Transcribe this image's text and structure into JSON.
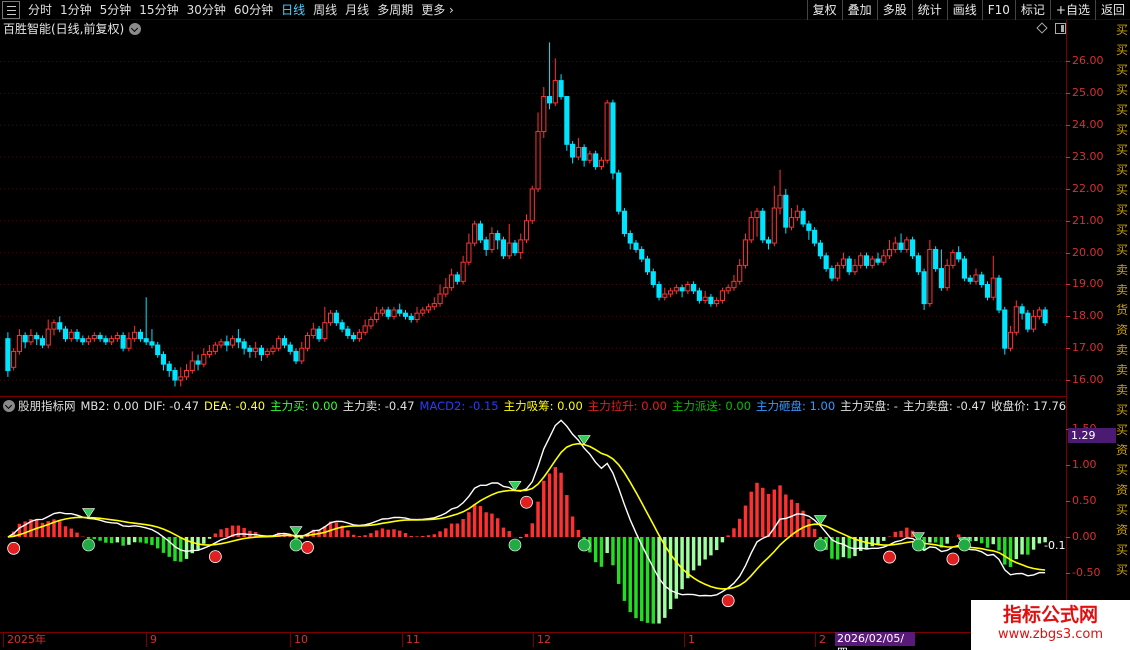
{
  "toolbar": {
    "period_tabs": [
      "分时",
      "1分钟",
      "5分钟",
      "15分钟",
      "30分钟",
      "60分钟",
      "日线",
      "周线",
      "月线",
      "多周期",
      "更多"
    ],
    "active_tab": "日线",
    "more_label": "更多",
    "right_tools": [
      "复权",
      "叠加",
      "多股",
      "统计",
      "画线",
      "F10",
      "标记",
      "+自选",
      "返回"
    ]
  },
  "main_chart": {
    "title": "百胜智能(日线,前复权)",
    "price_ticks": [
      "26.00",
      "25.00",
      "24.00",
      "23.00",
      "22.00",
      "21.00",
      "20.00",
      "19.00",
      "18.00",
      "17.00",
      "16.00"
    ],
    "colors": {
      "up": "#ff3333",
      "down": "#00e5ff",
      "grid": "#6a0000"
    }
  },
  "indicator": {
    "name": "股朋指标网",
    "items": [
      {
        "text": "MB2: 0.00",
        "color": "#e0e0e0"
      },
      {
        "text": "DIF: -0.47",
        "color": "#e0e0e0"
      },
      {
        "text": "DEA: -0.40",
        "color": "#ffff33"
      },
      {
        "text": "主力买: 0.00",
        "color": "#33ff33"
      },
      {
        "text": "主力卖: -0.47",
        "color": "#e0e0e0"
      },
      {
        "text": "MACD2: -0.15",
        "color": "#2a3cff"
      },
      {
        "text": "主力吸筹: 0.00",
        "color": "#ffff00"
      },
      {
        "text": "主力拉升: 0.00",
        "color": "#e02020"
      },
      {
        "text": "主力派送: 0.00",
        "color": "#00c000"
      },
      {
        "text": "主力砸盘: 1.00",
        "color": "#3399ff"
      },
      {
        "text": "主力买盘: -",
        "color": "#e0e0e0"
      },
      {
        "text": "主力卖盘: -0.47",
        "color": "#e0e0e0"
      },
      {
        "text": "收盘价: 17.76",
        "color": "#e0e0e0"
      }
    ],
    "axis_ticks": [
      "1.50",
      "1.00",
      "0.50",
      "0.00",
      "-0.50"
    ],
    "current_value": "1.29",
    "right_value": "-0.1",
    "marker_buy": "买",
    "marker_sell": "卖",
    "marker_empty": "空"
  },
  "date_axis": {
    "labels": [
      "2025年",
      "9",
      "10",
      "11",
      "12",
      "1",
      "2"
    ],
    "highlighted_date": "2026/02/05/四"
  },
  "right_strip_text": "买买买买买买买买买买买买卖卖货资卖卖卖买买资买资买资买买",
  "watermark": {
    "title": "指标公式网",
    "url": "www.zbgs3.com"
  },
  "chart_data": {
    "type": "candlestick",
    "title": "百胜智能(日线,前复权)",
    "ylim": [
      15.5,
      26.8
    ],
    "x_labels": [
      "2025年",
      "9",
      "10",
      "11",
      "12",
      "1",
      "2"
    ],
    "candles": [
      [
        17.3,
        16.3,
        17.5,
        16.1
      ],
      [
        16.4,
        16.9,
        17.0,
        16.3
      ],
      [
        16.9,
        17.4,
        17.6,
        16.8
      ],
      [
        17.4,
        17.2,
        17.5,
        17.0
      ],
      [
        17.2,
        17.4,
        17.6,
        17.1
      ],
      [
        17.4,
        17.3,
        17.5,
        17.1
      ],
      [
        17.3,
        17.1,
        17.4,
        17.0
      ],
      [
        17.1,
        17.6,
        17.9,
        17.0
      ],
      [
        17.6,
        17.8,
        17.9,
        17.4
      ],
      [
        17.8,
        17.6,
        18.0,
        17.5
      ],
      [
        17.6,
        17.3,
        17.7,
        17.2
      ],
      [
        17.3,
        17.5,
        17.6,
        17.2
      ],
      [
        17.5,
        17.3,
        17.6,
        17.2
      ],
      [
        17.3,
        17.2,
        17.4,
        17.1
      ],
      [
        17.2,
        17.3,
        17.4,
        17.1
      ],
      [
        17.3,
        17.4,
        17.5,
        17.2
      ],
      [
        17.4,
        17.3,
        17.5,
        17.2
      ],
      [
        17.3,
        17.2,
        17.4,
        17.1
      ],
      [
        17.2,
        17.3,
        17.4,
        17.1
      ],
      [
        17.3,
        17.4,
        17.5,
        17.2
      ],
      [
        17.4,
        17.0,
        17.5,
        16.9
      ],
      [
        17.0,
        17.3,
        17.5,
        16.9
      ],
      [
        17.3,
        17.5,
        17.7,
        17.2
      ],
      [
        17.5,
        17.3,
        17.6,
        17.2
      ],
      [
        17.3,
        17.2,
        18.6,
        17.1
      ],
      [
        17.2,
        17.1,
        17.6,
        17.0
      ],
      [
        17.1,
        16.8,
        17.2,
        16.7
      ],
      [
        16.8,
        16.5,
        16.9,
        16.3
      ],
      [
        16.5,
        16.3,
        16.6,
        16.1
      ],
      [
        16.3,
        16.0,
        16.4,
        15.8
      ],
      [
        16.0,
        16.1,
        16.4,
        15.8
      ],
      [
        16.1,
        16.3,
        16.5,
        16.0
      ],
      [
        16.3,
        16.6,
        16.9,
        16.2
      ],
      [
        16.6,
        16.5,
        16.8,
        16.3
      ],
      [
        16.5,
        16.8,
        17.0,
        16.4
      ],
      [
        16.8,
        16.9,
        17.1,
        16.7
      ],
      [
        16.9,
        17.1,
        17.2,
        16.8
      ],
      [
        17.1,
        17.2,
        17.3,
        17.0
      ],
      [
        17.2,
        17.1,
        17.4,
        16.9
      ],
      [
        17.1,
        17.3,
        17.4,
        17.0
      ],
      [
        17.3,
        17.2,
        17.6,
        17.0
      ],
      [
        17.2,
        17.0,
        17.3,
        16.8
      ],
      [
        17.0,
        16.9,
        17.1,
        16.7
      ],
      [
        16.9,
        17.0,
        17.2,
        16.7
      ],
      [
        17.0,
        16.8,
        17.1,
        16.6
      ],
      [
        16.8,
        16.9,
        17.0,
        16.7
      ],
      [
        16.9,
        17.0,
        17.1,
        16.8
      ],
      [
        17.0,
        17.3,
        17.4,
        16.9
      ],
      [
        17.3,
        17.1,
        17.4,
        17.0
      ],
      [
        17.1,
        16.9,
        17.2,
        16.8
      ],
      [
        16.9,
        16.6,
        17.0,
        16.5
      ],
      [
        16.6,
        17.0,
        17.2,
        16.5
      ],
      [
        17.0,
        17.4,
        17.5,
        16.9
      ],
      [
        17.4,
        17.6,
        17.8,
        17.3
      ],
      [
        17.6,
        17.3,
        17.7,
        17.2
      ],
      [
        17.3,
        17.8,
        18.3,
        17.2
      ],
      [
        17.8,
        18.1,
        18.2,
        17.7
      ],
      [
        18.1,
        17.8,
        18.2,
        17.7
      ],
      [
        17.8,
        17.6,
        17.9,
        17.5
      ],
      [
        17.6,
        17.4,
        17.7,
        17.3
      ],
      [
        17.4,
        17.3,
        17.5,
        17.2
      ],
      [
        17.3,
        17.5,
        17.6,
        17.2
      ],
      [
        17.5,
        17.7,
        17.9,
        17.4
      ],
      [
        17.7,
        17.9,
        18.0,
        17.6
      ],
      [
        17.9,
        18.1,
        18.3,
        17.8
      ],
      [
        18.1,
        18.2,
        18.3,
        18.0
      ],
      [
        18.2,
        18.0,
        18.3,
        17.9
      ],
      [
        18.0,
        18.2,
        18.3,
        17.9
      ],
      [
        18.2,
        18.1,
        18.4,
        18.0
      ],
      [
        18.1,
        18.0,
        18.2,
        17.9
      ],
      [
        18.0,
        17.9,
        18.1,
        17.8
      ],
      [
        17.9,
        18.1,
        18.3,
        17.8
      ],
      [
        18.1,
        18.2,
        18.3,
        18.0
      ],
      [
        18.2,
        18.3,
        18.4,
        18.1
      ],
      [
        18.3,
        18.4,
        18.6,
        18.2
      ],
      [
        18.4,
        18.7,
        19.0,
        18.3
      ],
      [
        18.7,
        18.9,
        19.2,
        18.6
      ],
      [
        18.9,
        19.3,
        19.5,
        18.8
      ],
      [
        19.3,
        19.1,
        19.4,
        19.0
      ],
      [
        19.1,
        19.7,
        19.9,
        19.0
      ],
      [
        19.7,
        20.3,
        20.6,
        19.6
      ],
      [
        20.3,
        20.9,
        21.0,
        20.2
      ],
      [
        20.9,
        20.4,
        21.0,
        20.3
      ],
      [
        20.4,
        20.1,
        20.5,
        19.9
      ],
      [
        20.1,
        20.6,
        20.8,
        20.0
      ],
      [
        20.6,
        20.4,
        20.7,
        20.1
      ],
      [
        20.4,
        19.9,
        20.5,
        19.8
      ],
      [
        19.9,
        20.3,
        20.9,
        19.8
      ],
      [
        20.3,
        20.0,
        20.4,
        19.9
      ],
      [
        20.0,
        20.4,
        20.6,
        19.8
      ],
      [
        20.4,
        21.0,
        21.2,
        20.3
      ],
      [
        21.0,
        22.0,
        22.1,
        20.9
      ],
      [
        22.0,
        23.8,
        24.4,
        21.9
      ],
      [
        23.8,
        24.9,
        25.2,
        23.6
      ],
      [
        24.9,
        24.7,
        26.6,
        24.5
      ],
      [
        24.7,
        25.4,
        26.1,
        24.6
      ],
      [
        25.4,
        24.9,
        25.6,
        24.8
      ],
      [
        24.9,
        23.4,
        24.9,
        23.2
      ],
      [
        23.4,
        23.0,
        23.5,
        22.8
      ],
      [
        23.0,
        23.3,
        23.6,
        22.9
      ],
      [
        23.3,
        22.9,
        23.4,
        22.7
      ],
      [
        22.9,
        23.1,
        23.2,
        22.8
      ],
      [
        23.1,
        22.7,
        23.2,
        22.6
      ],
      [
        22.7,
        22.9,
        23.0,
        22.6
      ],
      [
        22.9,
        24.7,
        24.8,
        22.8
      ],
      [
        24.7,
        22.5,
        24.8,
        22.3
      ],
      [
        22.5,
        21.3,
        22.6,
        21.2
      ],
      [
        21.3,
        20.6,
        21.4,
        20.5
      ],
      [
        20.6,
        20.3,
        20.7,
        20.1
      ],
      [
        20.3,
        20.1,
        20.4,
        20.0
      ],
      [
        20.1,
        19.8,
        20.2,
        19.7
      ],
      [
        19.8,
        19.4,
        19.9,
        19.3
      ],
      [
        19.4,
        19.0,
        19.5,
        18.9
      ],
      [
        19.0,
        18.6,
        19.1,
        18.5
      ],
      [
        18.6,
        18.7,
        18.9,
        18.5
      ],
      [
        18.7,
        18.8,
        18.9,
        18.6
      ],
      [
        18.8,
        18.9,
        19.0,
        18.7
      ],
      [
        18.9,
        18.8,
        19.0,
        18.6
      ],
      [
        18.8,
        19.0,
        19.1,
        18.7
      ],
      [
        19.0,
        18.8,
        19.1,
        18.7
      ],
      [
        18.8,
        18.5,
        18.9,
        18.4
      ],
      [
        18.5,
        18.6,
        18.8,
        18.4
      ],
      [
        18.6,
        18.4,
        18.7,
        18.3
      ],
      [
        18.4,
        18.5,
        18.6,
        18.3
      ],
      [
        18.5,
        18.8,
        18.9,
        18.4
      ],
      [
        18.8,
        18.9,
        19.0,
        18.7
      ],
      [
        18.9,
        19.1,
        19.3,
        18.8
      ],
      [
        19.1,
        19.6,
        19.8,
        19.0
      ],
      [
        19.6,
        20.4,
        20.6,
        19.5
      ],
      [
        20.4,
        21.1,
        21.3,
        20.3
      ],
      [
        21.1,
        21.3,
        21.4,
        20.5
      ],
      [
        21.3,
        20.4,
        21.4,
        20.3
      ],
      [
        20.4,
        20.3,
        20.5,
        20.1
      ],
      [
        20.3,
        21.4,
        22.1,
        20.2
      ],
      [
        21.4,
        21.8,
        22.6,
        21.2
      ],
      [
        21.8,
        20.8,
        22.0,
        20.6
      ],
      [
        20.8,
        21.1,
        21.4,
        20.7
      ],
      [
        21.1,
        21.3,
        21.5,
        21.0
      ],
      [
        21.3,
        20.9,
        21.4,
        20.8
      ],
      [
        20.9,
        20.7,
        21.0,
        20.4
      ],
      [
        20.7,
        20.3,
        20.8,
        20.2
      ],
      [
        20.3,
        19.9,
        20.4,
        19.8
      ],
      [
        19.9,
        19.5,
        20.0,
        19.4
      ],
      [
        19.5,
        19.2,
        19.6,
        19.1
      ],
      [
        19.2,
        19.6,
        19.7,
        19.1
      ],
      [
        19.6,
        19.8,
        20.0,
        19.5
      ],
      [
        19.8,
        19.4,
        19.9,
        19.3
      ],
      [
        19.4,
        19.6,
        19.8,
        19.3
      ],
      [
        19.6,
        19.9,
        20.0,
        19.5
      ],
      [
        19.9,
        19.6,
        20.0,
        19.5
      ],
      [
        19.6,
        19.8,
        19.9,
        19.5
      ],
      [
        19.8,
        19.7,
        20.0,
        19.6
      ],
      [
        19.7,
        19.9,
        20.1,
        19.6
      ],
      [
        19.9,
        20.1,
        20.4,
        19.8
      ],
      [
        20.1,
        20.3,
        20.5,
        20.0
      ],
      [
        20.3,
        20.1,
        20.6,
        20.0
      ],
      [
        20.1,
        20.4,
        20.5,
        20.0
      ],
      [
        20.4,
        19.9,
        20.5,
        19.8
      ],
      [
        19.9,
        19.4,
        20.0,
        19.3
      ],
      [
        19.4,
        18.4,
        19.5,
        18.2
      ],
      [
        18.4,
        20.1,
        20.4,
        18.3
      ],
      [
        20.1,
        19.5,
        20.2,
        19.4
      ],
      [
        19.5,
        18.9,
        20.1,
        18.8
      ],
      [
        18.9,
        19.6,
        19.8,
        18.8
      ],
      [
        19.6,
        20.0,
        20.1,
        19.5
      ],
      [
        20.0,
        19.8,
        20.2,
        19.7
      ],
      [
        19.8,
        19.2,
        19.9,
        19.1
      ],
      [
        19.2,
        19.1,
        19.3,
        19.0
      ],
      [
        19.1,
        19.3,
        19.5,
        19.0
      ],
      [
        19.3,
        19.0,
        19.4,
        18.9
      ],
      [
        19.0,
        18.6,
        19.1,
        18.5
      ],
      [
        18.6,
        19.2,
        19.9,
        18.5
      ],
      [
        19.2,
        18.2,
        19.3,
        18.1
      ],
      [
        18.2,
        17.0,
        18.3,
        16.8
      ],
      [
        17.0,
        17.5,
        17.7,
        16.9
      ],
      [
        17.5,
        18.3,
        18.5,
        17.4
      ],
      [
        18.3,
        18.1,
        18.4,
        17.9
      ],
      [
        18.1,
        17.6,
        18.2,
        17.5
      ],
      [
        17.6,
        18.0,
        18.2,
        17.5
      ],
      [
        18.0,
        18.2,
        18.3,
        17.9
      ],
      [
        18.2,
        17.8,
        18.3,
        17.7
      ]
    ]
  }
}
